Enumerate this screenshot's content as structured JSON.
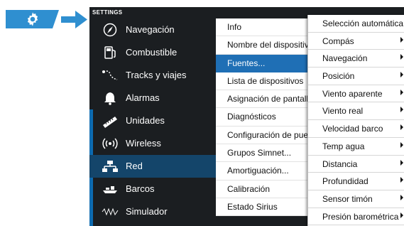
{
  "window": {
    "title": "SETTINGS"
  },
  "categories": [
    {
      "label": "Navegación",
      "icon": "compass-icon"
    },
    {
      "label": "Combustible",
      "icon": "fuel-pump-icon"
    },
    {
      "label": "Tracks y viajes",
      "icon": "tracks-icon"
    },
    {
      "label": "Alarmas",
      "icon": "bell-icon"
    },
    {
      "label": "Unidades",
      "icon": "ruler-icon"
    },
    {
      "label": "Wireless",
      "icon": "wireless-icon"
    },
    {
      "label": "Red",
      "icon": "network-icon"
    },
    {
      "label": "Barcos",
      "icon": "boats-icon"
    },
    {
      "label": "Simulador",
      "icon": "simulator-icon"
    }
  ],
  "selected_category": "Red",
  "submenu": [
    {
      "label": "Info"
    },
    {
      "label": "Nombre del dispositivo"
    },
    {
      "label": "Fuentes..."
    },
    {
      "label": "Lista de dispositivos"
    },
    {
      "label": "Asignación de pantallas"
    },
    {
      "label": "Diagnósticos"
    },
    {
      "label": "Configuración de puente"
    },
    {
      "label": "Grupos Simnet..."
    },
    {
      "label": "Amortiguación..."
    },
    {
      "label": "Calibración"
    },
    {
      "label": "Estado Sirius"
    }
  ],
  "selected_submenu": "Fuentes...",
  "dropdown": [
    {
      "label": "Selección automática",
      "has_submenu": false
    },
    {
      "label": "Compás",
      "has_submenu": true
    },
    {
      "label": "Navegación",
      "has_submenu": true
    },
    {
      "label": "Posición",
      "has_submenu": true
    },
    {
      "label": "Viento aparente",
      "has_submenu": true
    },
    {
      "label": "Viento real",
      "has_submenu": true
    },
    {
      "label": "Velocidad barco",
      "has_submenu": true
    },
    {
      "label": "Temp agua",
      "has_submenu": true
    },
    {
      "label": "Distancia",
      "has_submenu": true
    },
    {
      "label": "Profundidad",
      "has_submenu": true
    },
    {
      "label": "Sensor timón",
      "has_submenu": true
    },
    {
      "label": "Presión barométrica",
      "has_submenu": true
    }
  ],
  "colors": {
    "banner": "#2f8fd0",
    "window_bg": "#1b1e21",
    "selected_category": "#14456a",
    "selected_submenu": "#1f6fb5",
    "accent_strip": "#0d6bb0"
  }
}
